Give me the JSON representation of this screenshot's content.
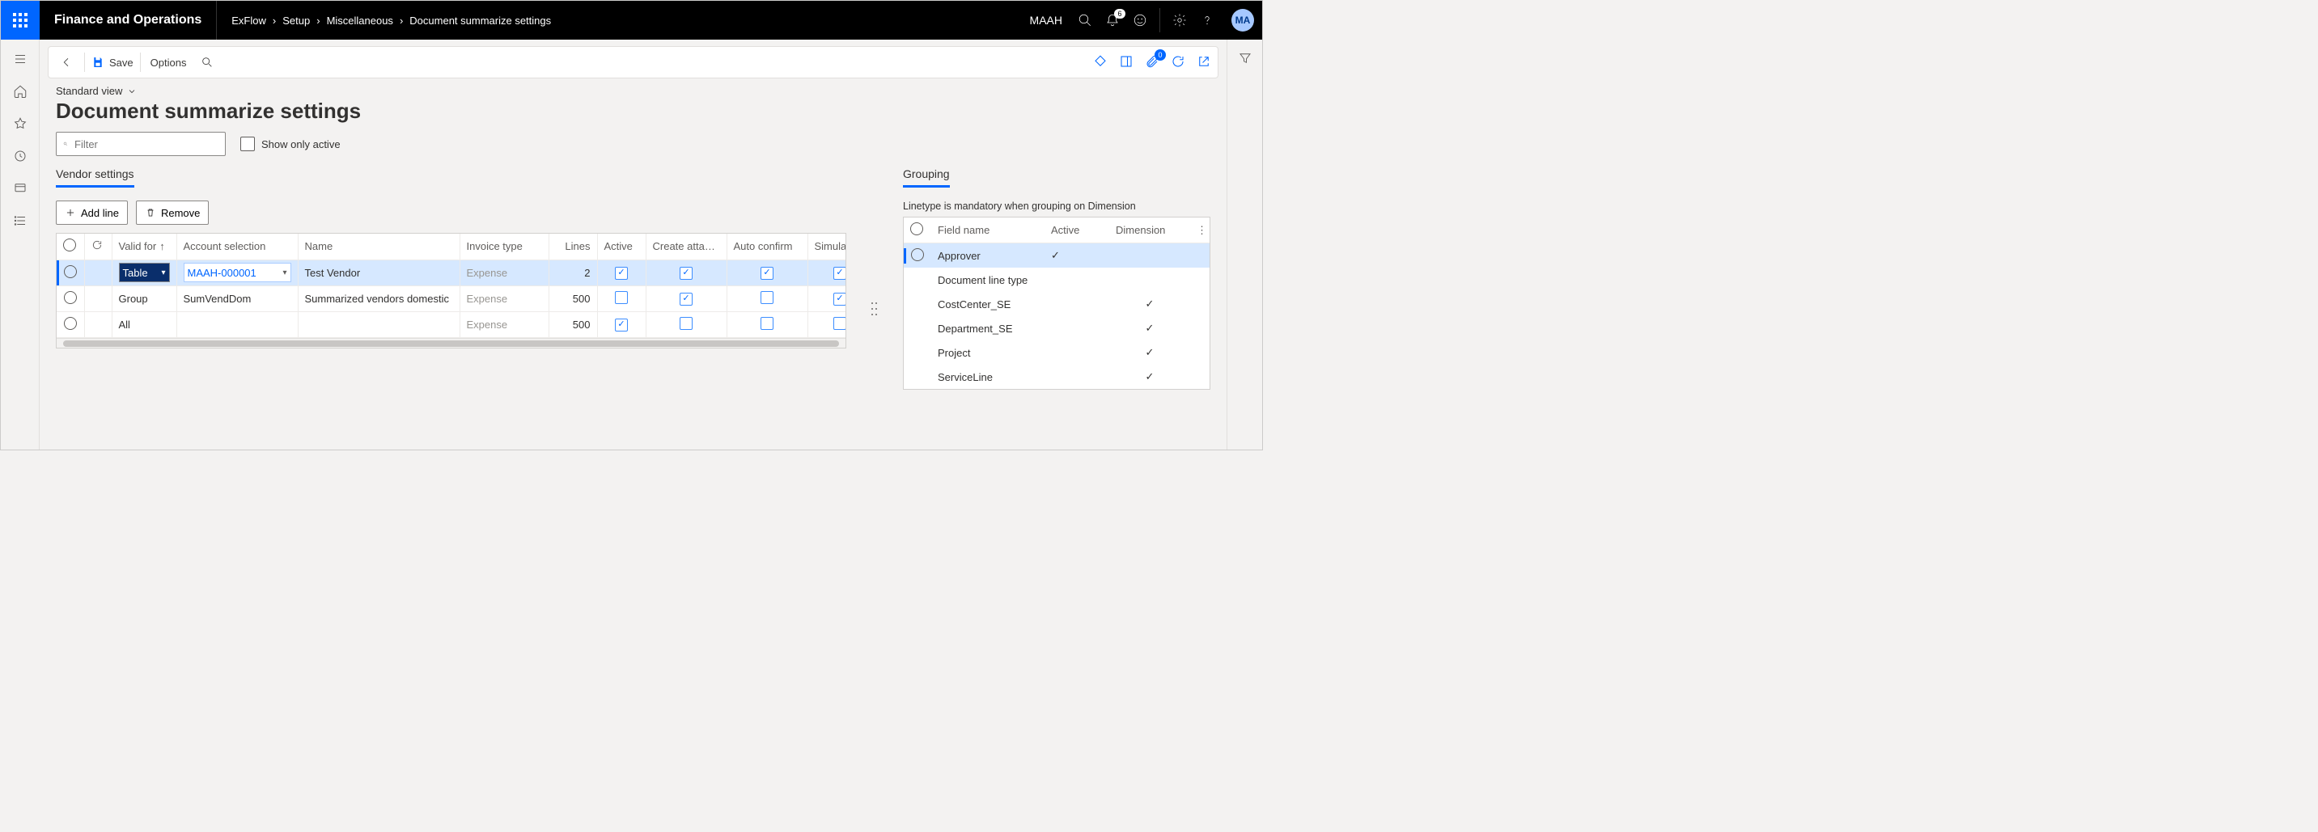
{
  "app_title": "Finance and Operations",
  "breadcrumb": [
    "ExFlow",
    "Setup",
    "Miscellaneous",
    "Document summarize settings"
  ],
  "user": "MAAH",
  "avatar": "MA",
  "bell_count": "6",
  "cmdbar": {
    "save": "Save",
    "options": "Options",
    "pin_badge": "0"
  },
  "view_label": "Standard view",
  "page_title": "Document summarize settings",
  "filter_placeholder": "Filter",
  "show_only_active": "Show only active",
  "left": {
    "tab": "Vendor settings",
    "add_line": "Add line",
    "remove": "Remove",
    "cols": {
      "valid_for": "Valid for",
      "account_selection": "Account selection",
      "name": "Name",
      "invoice_type": "Invoice type",
      "lines": "Lines",
      "active": "Active",
      "create_attach": "Create attach...",
      "auto_confirm": "Auto confirm",
      "simulate": "Simulate"
    },
    "rows": [
      {
        "selected": true,
        "valid_for": "Table",
        "account": "MAAH-000001",
        "name": "Test Vendor",
        "invoice_type": "Expense",
        "lines": "2",
        "active": true,
        "create_attach": true,
        "auto_confirm": true,
        "simulate": true
      },
      {
        "selected": false,
        "valid_for": "Group",
        "account": "SumVendDom",
        "name": "Summarized vendors domestic",
        "invoice_type": "Expense",
        "lines": "500",
        "active": false,
        "create_attach": true,
        "auto_confirm": false,
        "simulate": true
      },
      {
        "selected": false,
        "valid_for": "All",
        "account": "",
        "name": "",
        "invoice_type": "Expense",
        "lines": "500",
        "active": true,
        "create_attach": false,
        "auto_confirm": false,
        "simulate": false
      }
    ]
  },
  "right": {
    "tab": "Grouping",
    "note": "Linetype is mandatory when grouping on Dimension",
    "cols": {
      "field": "Field name",
      "active": "Active",
      "dimension": "Dimension"
    },
    "rows": [
      {
        "selected": true,
        "field": "Approver",
        "active": true,
        "dimension": false
      },
      {
        "selected": false,
        "field": "Document line type",
        "active": false,
        "dimension": false
      },
      {
        "selected": false,
        "field": "CostCenter_SE",
        "active": false,
        "dimension": true
      },
      {
        "selected": false,
        "field": "Department_SE",
        "active": false,
        "dimension": true
      },
      {
        "selected": false,
        "field": "Project",
        "active": false,
        "dimension": true
      },
      {
        "selected": false,
        "field": "ServiceLine",
        "active": false,
        "dimension": true
      }
    ]
  }
}
